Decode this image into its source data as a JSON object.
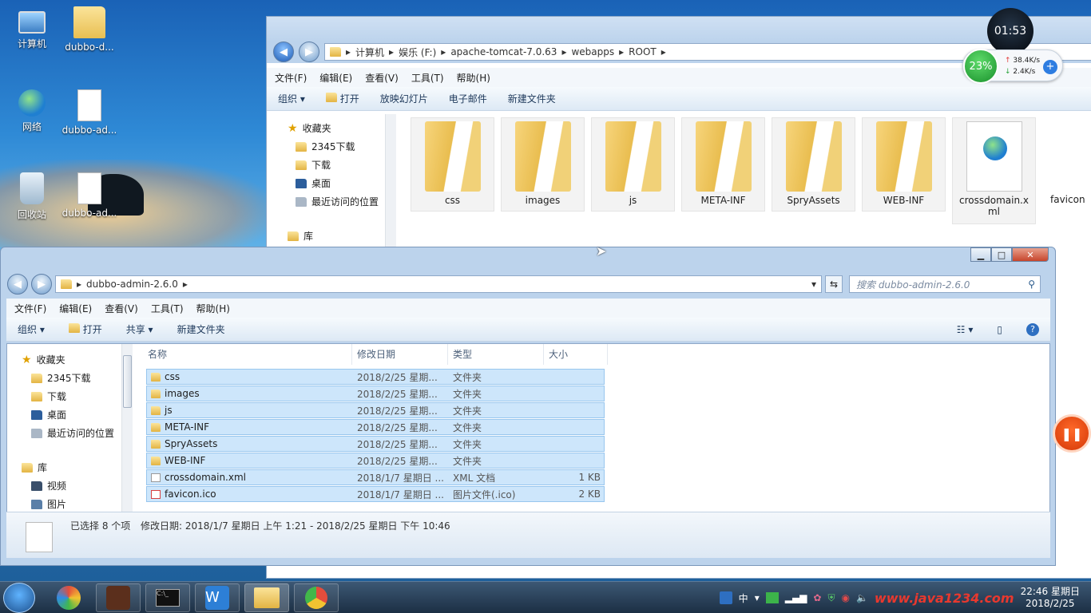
{
  "desktop": {
    "icons": [
      {
        "label": "计算机"
      },
      {
        "label": "dubbo-d..."
      },
      {
        "label": "网络"
      },
      {
        "label": "dubbo-ad..."
      },
      {
        "label": "回收站"
      },
      {
        "label": "dubbo-ad..."
      }
    ]
  },
  "back_window": {
    "breadcrumb": [
      "计算机",
      "娱乐 (F:)",
      "apache-tomcat-7.0.63",
      "webapps",
      "ROOT"
    ],
    "menu": [
      "文件(F)",
      "编辑(E)",
      "查看(V)",
      "工具(T)",
      "帮助(H)"
    ],
    "toolbar": [
      "组织",
      "打开",
      "放映幻灯片",
      "电子邮件",
      "新建文件夹"
    ],
    "nav": [
      "收藏夹",
      "2345下载",
      "下载",
      "桌面",
      "最近访问的位置",
      "库"
    ],
    "tiles": [
      "css",
      "images",
      "js",
      "META-INF",
      "SpryAssets",
      "WEB-INF",
      "crossdomain.x ml",
      "favicon"
    ]
  },
  "front_window": {
    "breadcrumb": "dubbo-admin-2.6.0",
    "search_placeholder": "搜索 dubbo-admin-2.6.0",
    "menu": [
      "文件(F)",
      "编辑(E)",
      "查看(V)",
      "工具(T)",
      "帮助(H)"
    ],
    "toolbar": {
      "organize": "组织",
      "open": "打开",
      "share": "共享",
      "new_folder": "新建文件夹"
    },
    "nav": [
      "收藏夹",
      "2345下载",
      "下载",
      "桌面",
      "最近访问的位置",
      "库",
      "视频",
      "图片"
    ],
    "columns": {
      "name": "名称",
      "date": "修改日期",
      "type": "类型",
      "size": "大小"
    },
    "files": [
      {
        "name": "css",
        "date": "2018/2/25 星期...",
        "type": "文件夹",
        "size": "",
        "icon": "folder"
      },
      {
        "name": "images",
        "date": "2018/2/25 星期...",
        "type": "文件夹",
        "size": "",
        "icon": "folder"
      },
      {
        "name": "js",
        "date": "2018/2/25 星期...",
        "type": "文件夹",
        "size": "",
        "icon": "folder"
      },
      {
        "name": "META-INF",
        "date": "2018/2/25 星期...",
        "type": "文件夹",
        "size": "",
        "icon": "folder"
      },
      {
        "name": "SpryAssets",
        "date": "2018/2/25 星期...",
        "type": "文件夹",
        "size": "",
        "icon": "folder"
      },
      {
        "name": "WEB-INF",
        "date": "2018/2/25 星期...",
        "type": "文件夹",
        "size": "",
        "icon": "folder"
      },
      {
        "name": "crossdomain.xml",
        "date": "2018/1/7 星期日 ...",
        "type": "XML 文档",
        "size": "1 KB",
        "icon": "xml"
      },
      {
        "name": "favicon.ico",
        "date": "2018/1/7 星期日 ...",
        "type": "图片文件(.ico)",
        "size": "2 KB",
        "icon": "ico"
      }
    ],
    "status": {
      "selected": "已选择 8 个项",
      "detail": "修改日期: 2018/1/7 星期日 上午 1:21 - 2018/2/25 星期日 下午 10:46"
    }
  },
  "overlay": {
    "timer": "01:53",
    "cpu_percent": "23%",
    "upload": "38.4K/s",
    "download": "2.4K/s"
  },
  "taskbar": {
    "ime": "中",
    "time": "22:46 星期日",
    "date": "2018/2/25",
    "watermark": "www.java1234.com"
  }
}
